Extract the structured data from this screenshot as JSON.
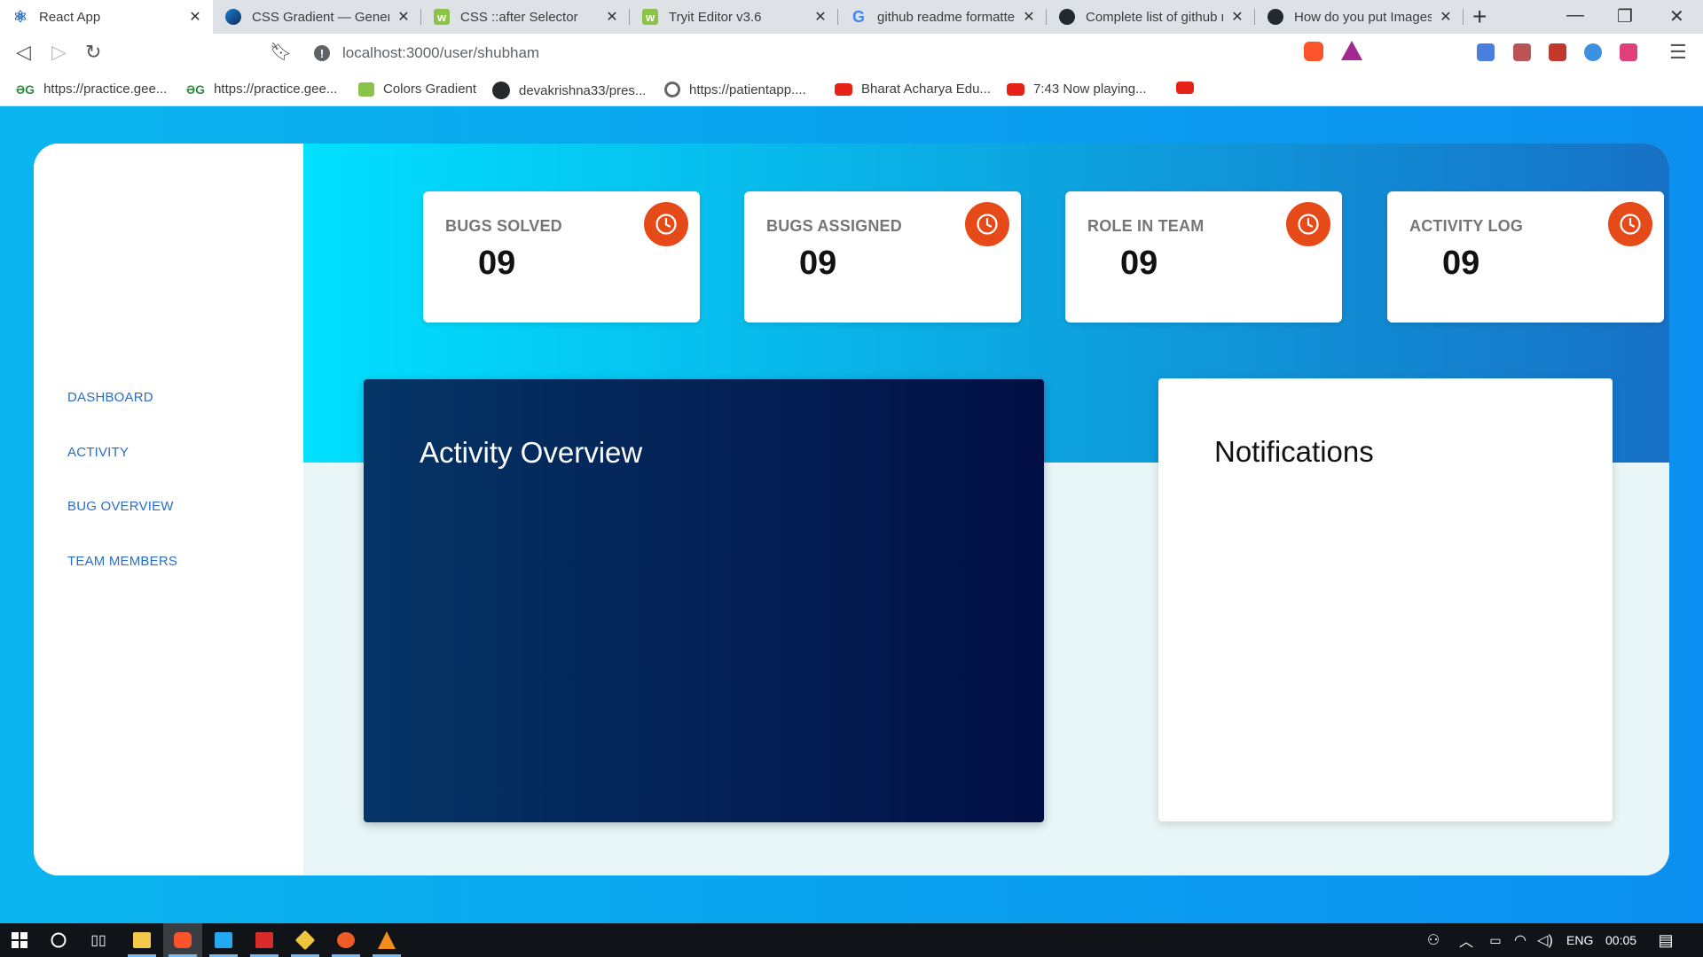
{
  "browser": {
    "tabs": [
      {
        "title": "React App",
        "icon": "react-icon",
        "active": true
      },
      {
        "title": "CSS Gradient — Generat",
        "icon": "cssgradient-icon",
        "active": false
      },
      {
        "title": "CSS ::after Selector",
        "icon": "w3schools-icon",
        "active": false
      },
      {
        "title": "Tryit Editor v3.6",
        "icon": "w3schools-icon",
        "active": false
      },
      {
        "title": "github readme formatter",
        "icon": "google-icon",
        "active": false
      },
      {
        "title": "Complete list of github m",
        "icon": "github-icon",
        "active": false
      },
      {
        "title": "How do you put Images",
        "icon": "github-icon",
        "active": false
      }
    ],
    "tab_close_glyph": "✕",
    "new_tab_glyph": "+",
    "url": "localhost:3000/user/shubham",
    "bookmarks": [
      {
        "label": "https://practice.gee...",
        "icon": "gfg-icon"
      },
      {
        "label": "https://practice.gee...",
        "icon": "gfg-icon"
      },
      {
        "label": "Colors Gradient",
        "icon": "colors-gradient-icon"
      },
      {
        "label": "devakrishna33/pres...",
        "icon": "github-icon"
      },
      {
        "label": "https://patientapp....",
        "icon": "globe-icon"
      },
      {
        "label": "Bharat Acharya Edu...",
        "icon": "youtube-icon"
      },
      {
        "label": "7:43 Now playing...",
        "icon": "youtube-icon"
      },
      {
        "label": "",
        "icon": "youtube-icon"
      }
    ],
    "gfg_glyph": "ƏG"
  },
  "sidebar": {
    "items": [
      {
        "label": "DASHBOARD"
      },
      {
        "label": "ACTIVITY"
      },
      {
        "label": "BUG OVERVIEW"
      },
      {
        "label": "TEAM MEMBERS"
      }
    ]
  },
  "stats": [
    {
      "label": "BUGS SOLVED",
      "value": "09",
      "icon": "clock-icon"
    },
    {
      "label": "BUGS ASSIGNED",
      "value": "09",
      "icon": "clock-icon"
    },
    {
      "label": "ROLE IN TEAM",
      "value": "09",
      "icon": "clock-icon"
    },
    {
      "label": "ACTIVITY LOG",
      "value": "09",
      "icon": "clock-icon"
    }
  ],
  "panels": {
    "activity_title": "Activity Overview",
    "notifications_title": "Notifications"
  },
  "taskbar": {
    "language": "ENG",
    "time": "00:05"
  },
  "colors": {
    "accent_orange": "#e64a19",
    "nav_blue": "#2b6ec6",
    "activity_dark": "#020f45"
  }
}
